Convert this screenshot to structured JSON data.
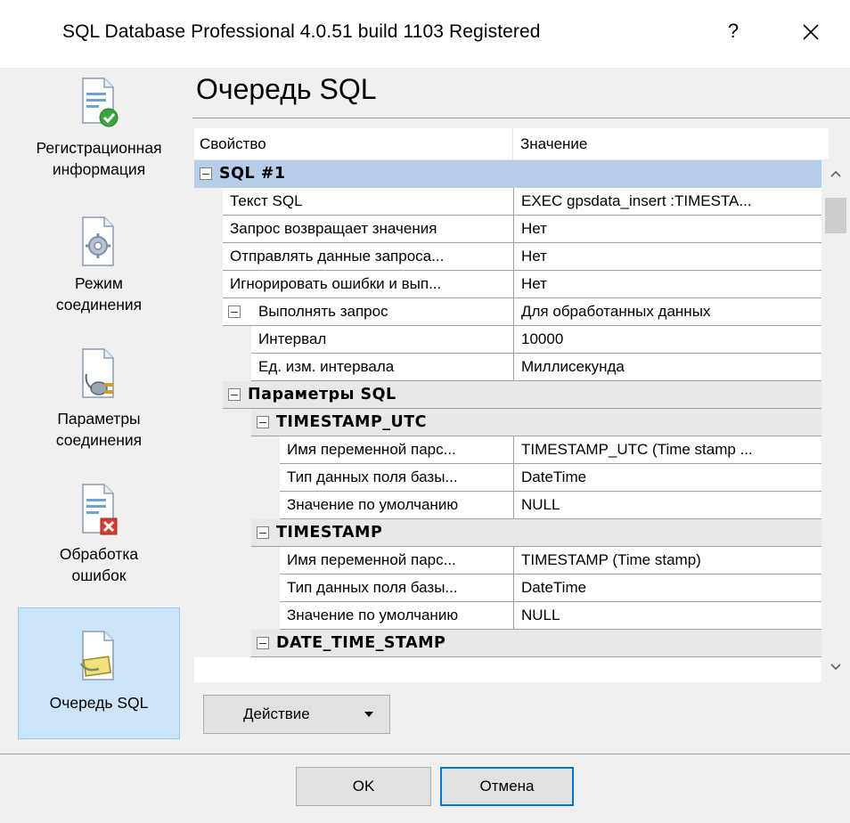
{
  "window": {
    "title": "SQL Database Professional 4.0.51 build 1103 Registered",
    "help_label": "?"
  },
  "nav": {
    "items": [
      {
        "label_line1": "Регистрационная",
        "label_line2": "информация",
        "icon": "document-check-icon"
      },
      {
        "label_line1": "Режим",
        "label_line2": "соединения",
        "icon": "document-gear-icon"
      },
      {
        "label_line1": "Параметры",
        "label_line2": "соединения",
        "icon": "document-plug-icon"
      },
      {
        "label_line1": "Обработка",
        "label_line2": "ошибок",
        "icon": "document-error-icon"
      },
      {
        "label_line1": "Очередь SQL",
        "label_line2": "",
        "icon": "document-queue-icon",
        "active": true
      }
    ]
  },
  "page": {
    "title": "Очередь SQL"
  },
  "grid": {
    "col_property": "Свойство",
    "col_value": "Значение",
    "rows": [
      {
        "kind": "cat",
        "label": "SQL #1",
        "level": 0,
        "selected": true
      },
      {
        "kind": "prop",
        "name": "Текст SQL",
        "value": "EXEC gpsdata_insert :TIMESTA...",
        "level": 1
      },
      {
        "kind": "prop",
        "name": "Запрос возвращает значения",
        "value": "Нет",
        "level": 1
      },
      {
        "kind": "prop",
        "name": "Отправлять данные запроса...",
        "value": "Нет",
        "level": 1
      },
      {
        "kind": "prop",
        "name": "Игнорировать ошибки и вып...",
        "value": "Нет",
        "level": 1
      },
      {
        "kind": "propexp",
        "name": "Выполнять запрос",
        "value": "Для обработанных данных",
        "level": 1
      },
      {
        "kind": "prop",
        "name": "Интервал",
        "value": "10000",
        "level": 2
      },
      {
        "kind": "prop",
        "name": "Ед. изм. интервала",
        "value": "Миллисекунда",
        "level": 2
      },
      {
        "kind": "cat",
        "label": "Параметры SQL",
        "level": 1
      },
      {
        "kind": "cat",
        "label": "TIMESTAMP_UTC",
        "level": 2
      },
      {
        "kind": "prop",
        "name": "Имя переменной парс...",
        "value": "TIMESTAMP_UTC (Time stamp ...",
        "level": 3
      },
      {
        "kind": "prop",
        "name": "Тип данных поля базы...",
        "value": "DateTime",
        "level": 3
      },
      {
        "kind": "prop",
        "name": "Значение по умолчанию",
        "value": "NULL",
        "level": 3
      },
      {
        "kind": "cat",
        "label": "TIMESTAMP",
        "level": 2
      },
      {
        "kind": "prop",
        "name": "Имя переменной парс...",
        "value": "TIMESTAMP (Time stamp)",
        "level": 3
      },
      {
        "kind": "prop",
        "name": "Тип данных поля базы...",
        "value": "DateTime",
        "level": 3
      },
      {
        "kind": "prop",
        "name": "Значение по умолчанию",
        "value": "NULL",
        "level": 3
      },
      {
        "kind": "cat",
        "label": "DATE_TIME_STAMP",
        "level": 2
      }
    ]
  },
  "actions": {
    "action_label": "Действие"
  },
  "footer": {
    "ok_label": "OK",
    "cancel_label": "Отмена"
  },
  "colors": {
    "selected_category": "#b7cde8",
    "active_nav": "#cce4f7",
    "focus_border": "#0078d7"
  }
}
